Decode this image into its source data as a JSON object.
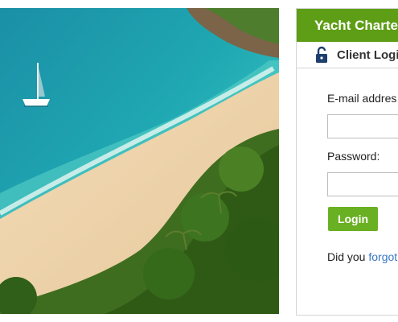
{
  "photo": {
    "alt_icon": "beach-yacht-photo"
  },
  "panel": {
    "header_title": "Yacht Charte",
    "client_login_label": "Client Logi",
    "email_label": "E-mail addres",
    "email_value": "",
    "password_label": "Password:",
    "password_value": "",
    "login_button": "Login",
    "forgot_prefix": "Did you ",
    "forgot_link": "forgot"
  },
  "colors": {
    "header_green": "#5e9e16",
    "button_green": "#6ab023",
    "link_blue": "#3a78c3"
  }
}
